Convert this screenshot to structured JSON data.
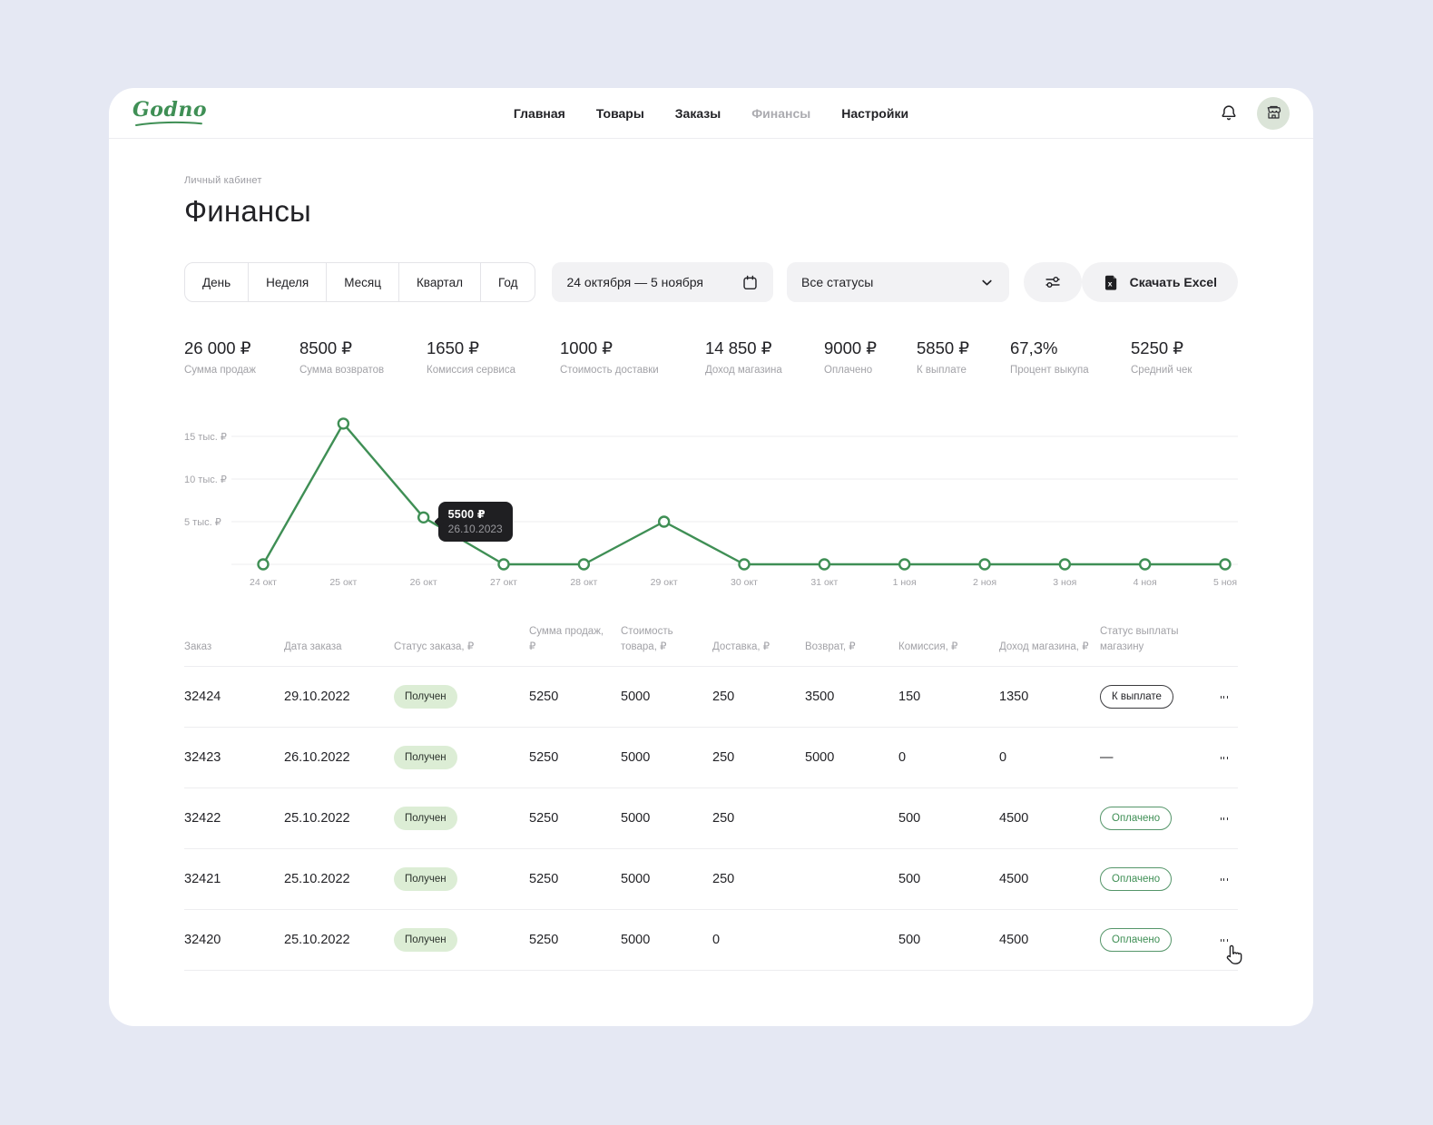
{
  "colors": {
    "accent_green": "#3f8f55",
    "page_bg": "#e5e8f3",
    "badge_bg": "#dcedd5",
    "tooltip_bg": "#1f1f22",
    "grid_line": "#ededef"
  },
  "header": {
    "logo_text": "Godno",
    "nav_items": [
      {
        "label": "Главная",
        "state": "default"
      },
      {
        "label": "Товары",
        "state": "default"
      },
      {
        "label": "Заказы",
        "state": "default"
      },
      {
        "label": "Финансы",
        "state": "current"
      },
      {
        "label": "Настройки",
        "state": "default"
      }
    ]
  },
  "page_header": {
    "breadcrumb": "Личный кабинет",
    "title": "Финансы"
  },
  "filters": {
    "period_options": [
      "День",
      "Неделя",
      "Месяц",
      "Квартал",
      "Год"
    ],
    "date_range_value": "24 октября — 5 ноября",
    "status_value": "Все статусы",
    "excel_button_label": "Скачать Excel"
  },
  "stats": [
    {
      "value": "26 000 ₽",
      "label": "Сумма продаж"
    },
    {
      "value": "8500 ₽",
      "label": "Сумма возвратов"
    },
    {
      "value": "1650 ₽",
      "label": "Комиссия сервиса"
    },
    {
      "value": "1000 ₽",
      "label": "Стоимость доставки"
    },
    {
      "value": "14 850 ₽",
      "label": "Доход магазина"
    },
    {
      "value": "9000 ₽",
      "label": "Оплачено"
    },
    {
      "value": "5850 ₽",
      "label": "К выплате"
    },
    {
      "value": "67,3%",
      "label": "Процент выкупа"
    },
    {
      "value": "5250 ₽",
      "label": "Средний чек"
    }
  ],
  "chart_data": {
    "type": "line",
    "x": [
      "24 окт",
      "25 окт",
      "26 окт",
      "27 окт",
      "28 окт",
      "29 окт",
      "30 окт",
      "31 окт",
      "1 ноя",
      "2 ноя",
      "3 ноя",
      "4 ноя",
      "5 ноя"
    ],
    "values": [
      0,
      16500,
      5500,
      0,
      0,
      5000,
      0,
      0,
      0,
      0,
      0,
      0,
      0
    ],
    "y_ticks": [
      {
        "value": 15000,
        "label": "15 тыс. ₽"
      },
      {
        "value": 10000,
        "label": "10 тыс. ₽"
      },
      {
        "value": 5000,
        "label": "5 тыс. ₽"
      }
    ],
    "ylim": [
      0,
      17500
    ],
    "grid": true,
    "legend": "none",
    "line_color": "#3f8f55",
    "tooltip": {
      "value": "5500 ₽",
      "date": "26.10.2023",
      "point_index": 2
    }
  },
  "table": {
    "headers": [
      "Заказ",
      "Дата заказа",
      "Статус заказа, ₽",
      "Сумма продаж, ₽",
      "Стоимость товара, ₽",
      "Доставка, ₽",
      "Возврат, ₽",
      "Комиссия, ₽",
      "Доход магазина, ₽",
      "Статус выплаты магазину"
    ],
    "rows": [
      {
        "order": "32424",
        "date": "29.10.2022",
        "status": "Получен",
        "sales": "5250",
        "cost": "5000",
        "delivery": "250",
        "refund": "3500",
        "commission": "150",
        "income": "1350",
        "payout_label": "К выплате",
        "payout_variant": "dark"
      },
      {
        "order": "32423",
        "date": "26.10.2022",
        "status": "Получен",
        "sales": "5250",
        "cost": "5000",
        "delivery": "250",
        "refund": "5000",
        "commission": "0",
        "income": "0",
        "payout_label": "—",
        "payout_variant": "none"
      },
      {
        "order": "32422",
        "date": "25.10.2022",
        "status": "Получен",
        "sales": "5250",
        "cost": "5000",
        "delivery": "250",
        "refund": "",
        "commission": "500",
        "income": "4500",
        "payout_label": "Оплачено",
        "payout_variant": "green"
      },
      {
        "order": "32421",
        "date": "25.10.2022",
        "status": "Получен",
        "sales": "5250",
        "cost": "5000",
        "delivery": "250",
        "refund": "",
        "commission": "500",
        "income": "4500",
        "payout_label": "Оплачено",
        "payout_variant": "green"
      },
      {
        "order": "32420",
        "date": "25.10.2022",
        "status": "Получен",
        "sales": "5250",
        "cost": "5000",
        "delivery": "0",
        "refund": "",
        "commission": "500",
        "income": "4500",
        "payout_label": "Оплачено",
        "payout_variant": "green"
      }
    ]
  }
}
